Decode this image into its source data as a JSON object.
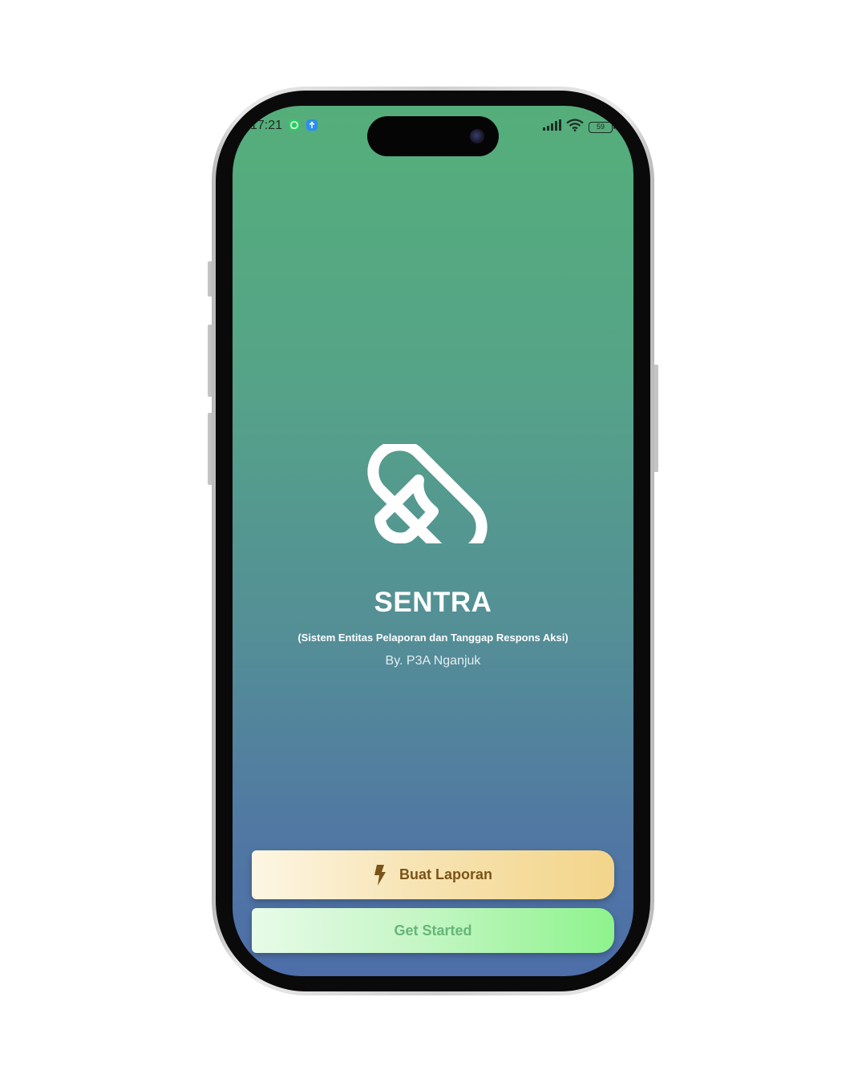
{
  "status_bar": {
    "time": "17:21",
    "battery": "59",
    "notifications": [
      "whatsapp-icon",
      "upload-icon"
    ],
    "indicators": [
      "signal-icon",
      "wifi-icon",
      "battery-icon"
    ]
  },
  "app": {
    "title": "SENTRA",
    "subtitle": "(Sistem Entitas Pelaporan dan Tanggap Respons Aksi)",
    "byline": "By. P3A Nganjuk",
    "logo_icon": "sentra-logo-icon"
  },
  "actions": {
    "report_label": "Buat Laporan",
    "report_icon": "lightning-bolt-icon",
    "start_label": "Get Started"
  },
  "colors": {
    "gradient_top": "#55ae7a",
    "gradient_bottom": "#4d6ea9",
    "report_button": "#f3d58a",
    "start_button": "#8ef38c"
  }
}
